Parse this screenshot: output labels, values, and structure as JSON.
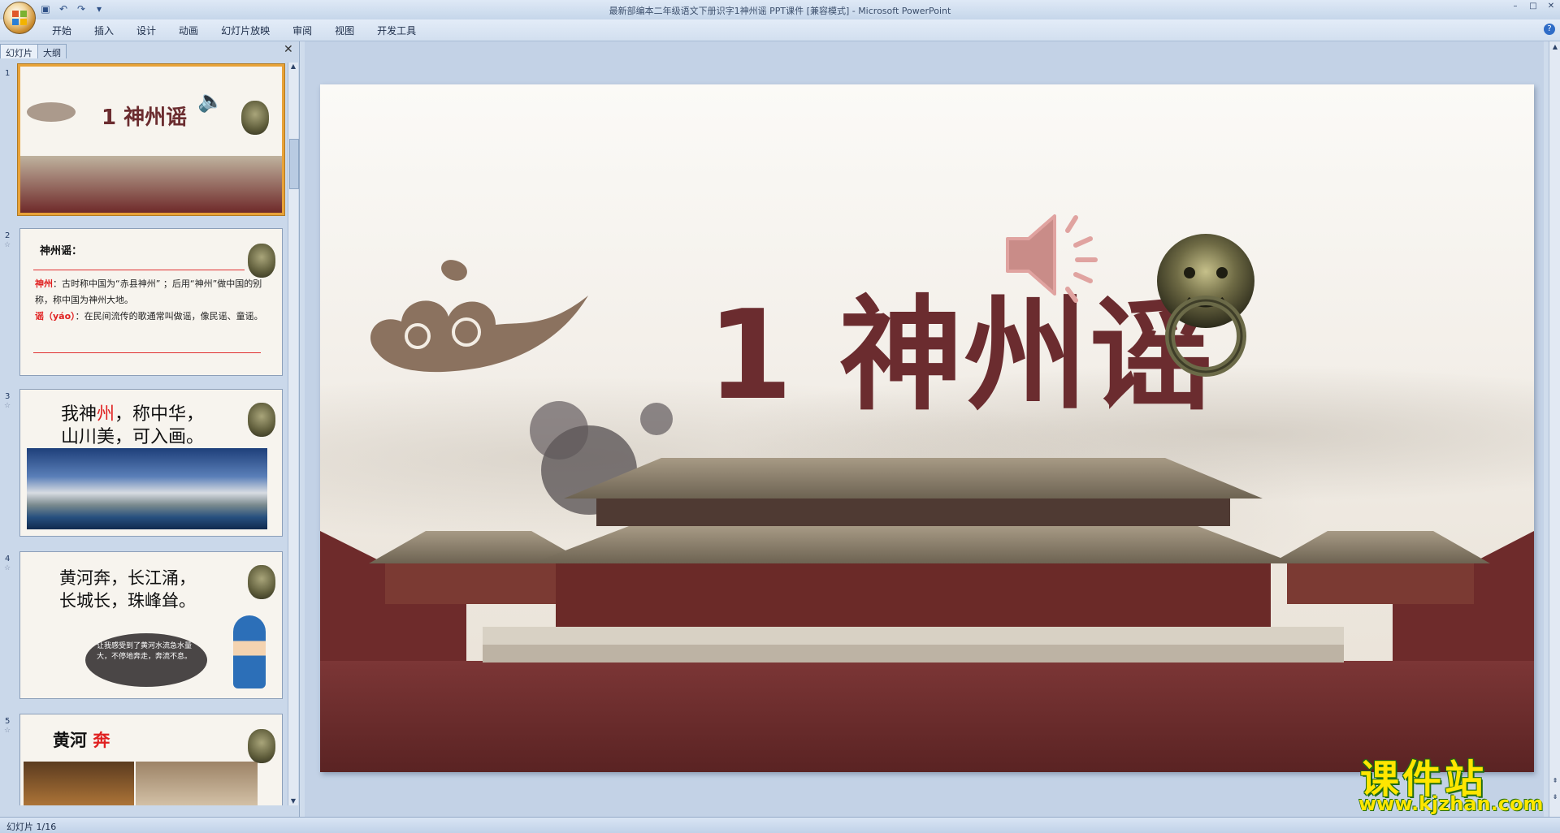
{
  "window": {
    "title": "最新部编本二年级语文下册识字1神州谣 PPT课件 [兼容模式] - Microsoft PowerPoint",
    "controls": [
      "–",
      "□",
      "✕"
    ]
  },
  "menu": {
    "tabs": [
      "开始",
      "插入",
      "设计",
      "动画",
      "幻灯片放映",
      "审阅",
      "视图",
      "开发工具"
    ]
  },
  "pane": {
    "tabs": [
      "幻灯片",
      "大纲"
    ],
    "close": "✕"
  },
  "thumbnails": [
    {
      "num": "1",
      "title": "1 神州谣"
    },
    {
      "num": "2",
      "heading": "神州谣：",
      "line1_key": "神州",
      "line1": "：古时称中国为“赤县神州”  ；后用“神州”做中国的别称，称中国为神州大地。",
      "line2_key": "谣（yáo）",
      "line2": "：在民间流传的歌通常叫做谣，像民谣、童谣。"
    },
    {
      "num": "3",
      "line1a": "我神",
      "line1b": "州",
      "line1c": "，称中华，",
      "line2": "山川美，可入画。"
    },
    {
      "num": "4",
      "line1": "黄河奔，长江涌，",
      "line2": "长城长，珠峰耸。",
      "bubble": "让我感受到了黄河水流急水量大，不停地奔走，奔流不息。"
    },
    {
      "num": "5",
      "text_a": "黄河",
      "text_b": "奔"
    }
  ],
  "slide": {
    "title": "1 神州谣"
  },
  "watermark": {
    "main": "课件站",
    "url": "www.kjzhan.com"
  },
  "status": {
    "text": "幻灯片 1/16"
  },
  "colors": {
    "title": "#6b2c2f",
    "accent_red": "#e02020",
    "watermark": "#ffe600"
  }
}
